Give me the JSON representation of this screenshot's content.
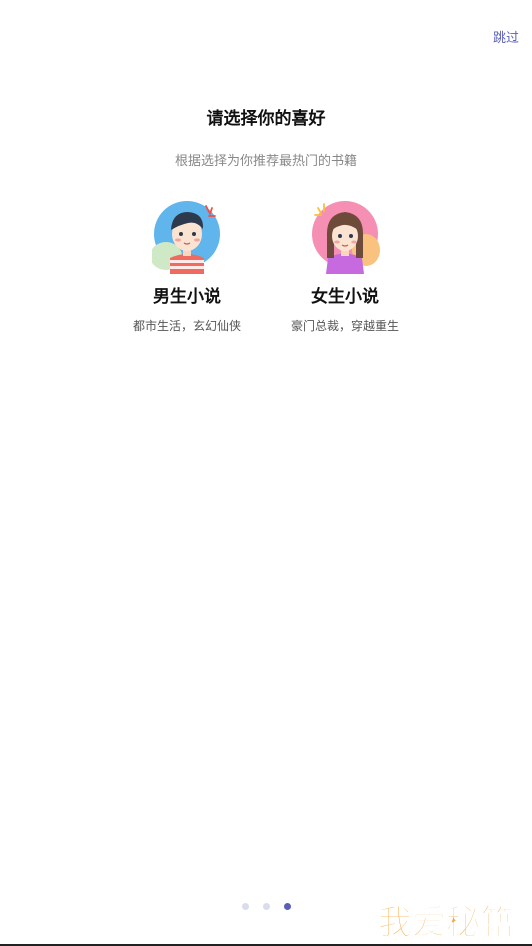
{
  "header": {
    "skip_label": "跳过"
  },
  "main": {
    "title": "请选择你的喜好",
    "subtitle": "根据选择为你推荐最热门的书籍"
  },
  "options": [
    {
      "name": "男生小说",
      "desc": "都市生活，玄幻仙侠",
      "icon": "male-avatar-icon"
    },
    {
      "name": "女生小说",
      "desc": "豪门总裁，穿越重生",
      "icon": "female-avatar-icon"
    }
  ],
  "pagination": {
    "count": 3,
    "active_index": 2
  },
  "watermark": {
    "text": "我爱秘籍"
  },
  "colors": {
    "accent": "#5b5fb8",
    "watermark": "#f3a53a"
  }
}
